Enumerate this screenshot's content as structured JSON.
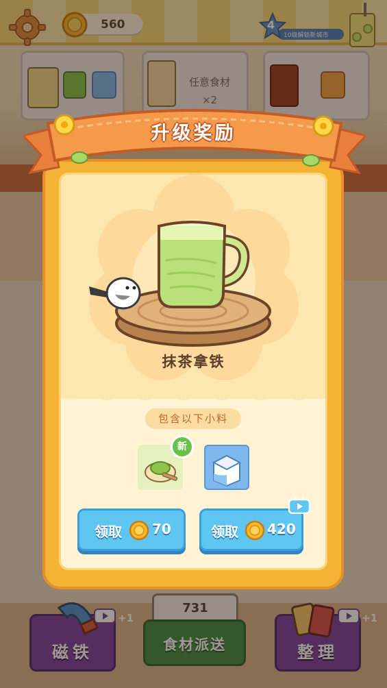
{
  "hud": {
    "coins": "560",
    "level": "4",
    "level_hint": "10级解锁新城市"
  },
  "orders": [
    {
      "text_line1": "",
      "text_line2": ""
    },
    {
      "text_line1": "任意食材",
      "text_line2": "×2"
    },
    {
      "text_line1": "",
      "text_line2": ""
    }
  ],
  "popup": {
    "title": "升级奖励",
    "item_name": "抹茶拿铁",
    "subtitle": "包含以下小料",
    "new_badge": "新",
    "ingredients": [
      {
        "name": "matcha-powder-icon",
        "is_new": true
      },
      {
        "name": "milk-carton-icon",
        "is_new": false
      }
    ],
    "claim_buttons": [
      {
        "label": "领取",
        "amount": "70",
        "has_video": false
      },
      {
        "label": "领取",
        "amount": "420",
        "has_video": true
      }
    ]
  },
  "bottom": {
    "magnet_label": "磁铁",
    "magnet_bonus": "+1",
    "dispatch_label": "食材派送",
    "dispatch_count": "731",
    "sort_label": "整理",
    "sort_bonus": "+1"
  },
  "colors": {
    "panel": "#f5b335",
    "ribbon": "#f49a4a",
    "claim_button": "#5fc6f2",
    "purple_button": "#7a3fa0",
    "green_button": "#3e8a42"
  }
}
